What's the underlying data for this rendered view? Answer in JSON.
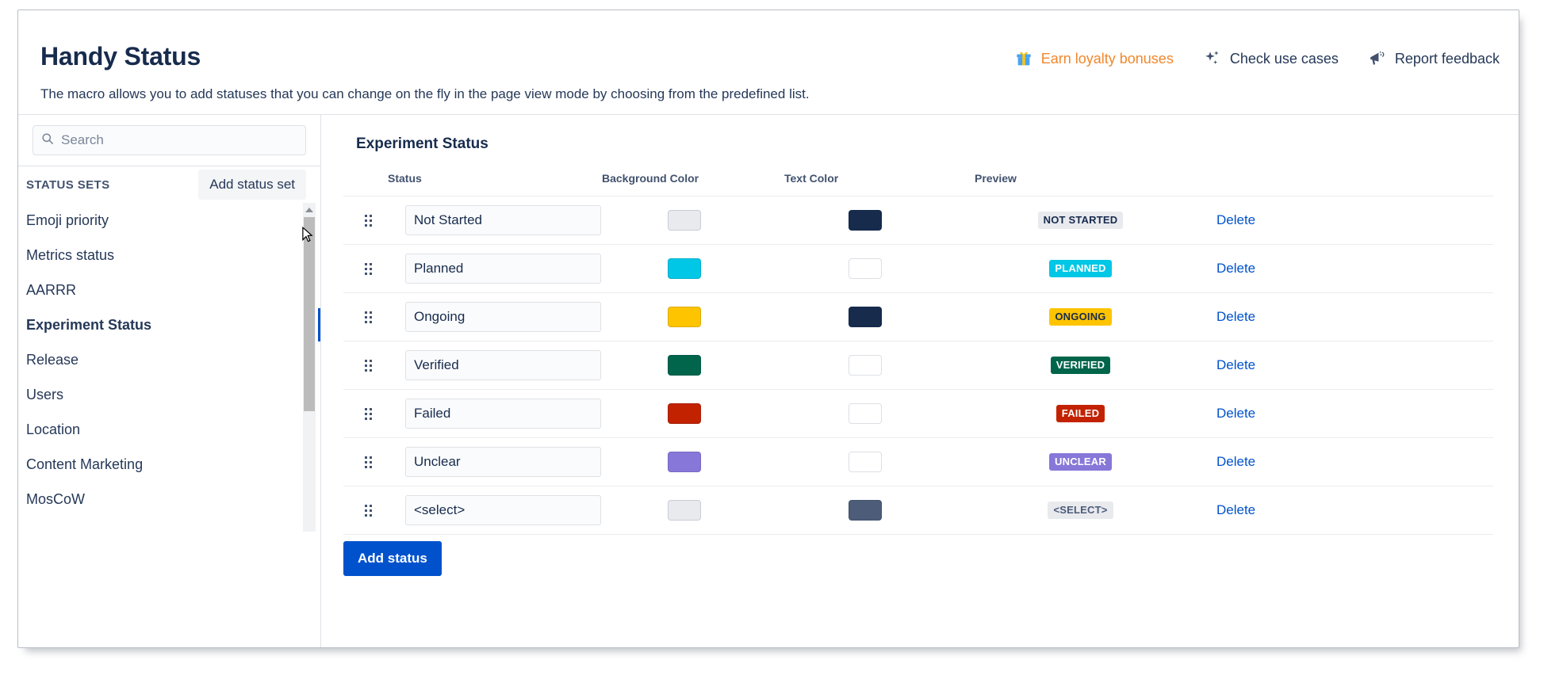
{
  "header": {
    "title": "Handy Status",
    "subtitle": "The macro allows you to add statuses that you can change on the fly in the page view mode by choosing from the predefined list.",
    "links": [
      {
        "label": "Earn loyalty bonuses",
        "icon": "gift-icon",
        "color": "#f1872b"
      },
      {
        "label": "Check use cases",
        "icon": "sparkles-icon",
        "color": "#253858"
      },
      {
        "label": "Report feedback",
        "icon": "megaphone-icon",
        "color": "#253858"
      }
    ]
  },
  "sidebar": {
    "search": {
      "placeholder": "Search",
      "value": "",
      "icon": "search-icon"
    },
    "section_label": "STATUS SETS",
    "add_set_label": "Add status set",
    "items": [
      {
        "label": "Emoji priority",
        "active": false
      },
      {
        "label": "Metrics status",
        "active": false
      },
      {
        "label": "AARRR",
        "active": false
      },
      {
        "label": "Experiment Status",
        "active": true
      },
      {
        "label": "Release",
        "active": false
      },
      {
        "label": "Users",
        "active": false
      },
      {
        "label": "Location",
        "active": false
      },
      {
        "label": "Content Marketing",
        "active": false
      },
      {
        "label": "MosCoW",
        "active": false
      }
    ],
    "active_indicator_color": "#0052cc"
  },
  "main": {
    "title": "Experiment Status",
    "columns": {
      "handle": "",
      "status": "Status",
      "background": "Background Color",
      "text": "Text Color",
      "preview": "Preview",
      "delete": ""
    },
    "delete_label": "Delete",
    "add_status_label": "Add status",
    "rows": [
      {
        "status": "Not Started",
        "bg": "#e9eaee",
        "fg": "#172b4d",
        "preview": "NOT STARTED"
      },
      {
        "status": "Planned",
        "bg": "#00c7e6",
        "fg": "#ffffff",
        "preview": "PLANNED"
      },
      {
        "status": "Ongoing",
        "bg": "#ffc400",
        "fg": "#172b4d",
        "preview": "ONGOING"
      },
      {
        "status": "Verified",
        "bg": "#00654a",
        "fg": "#ffffff",
        "preview": "VERIFIED"
      },
      {
        "status": "Failed",
        "bg": "#c22200",
        "fg": "#ffffff",
        "preview": "FAILED"
      },
      {
        "status": "Unclear",
        "bg": "#8777d9",
        "fg": "#ffffff",
        "preview": "UNCLEAR"
      },
      {
        "status": "<select>",
        "bg": "#e9eaee",
        "fg": "#4c5c79",
        "preview": "<SELECT>"
      }
    ]
  }
}
